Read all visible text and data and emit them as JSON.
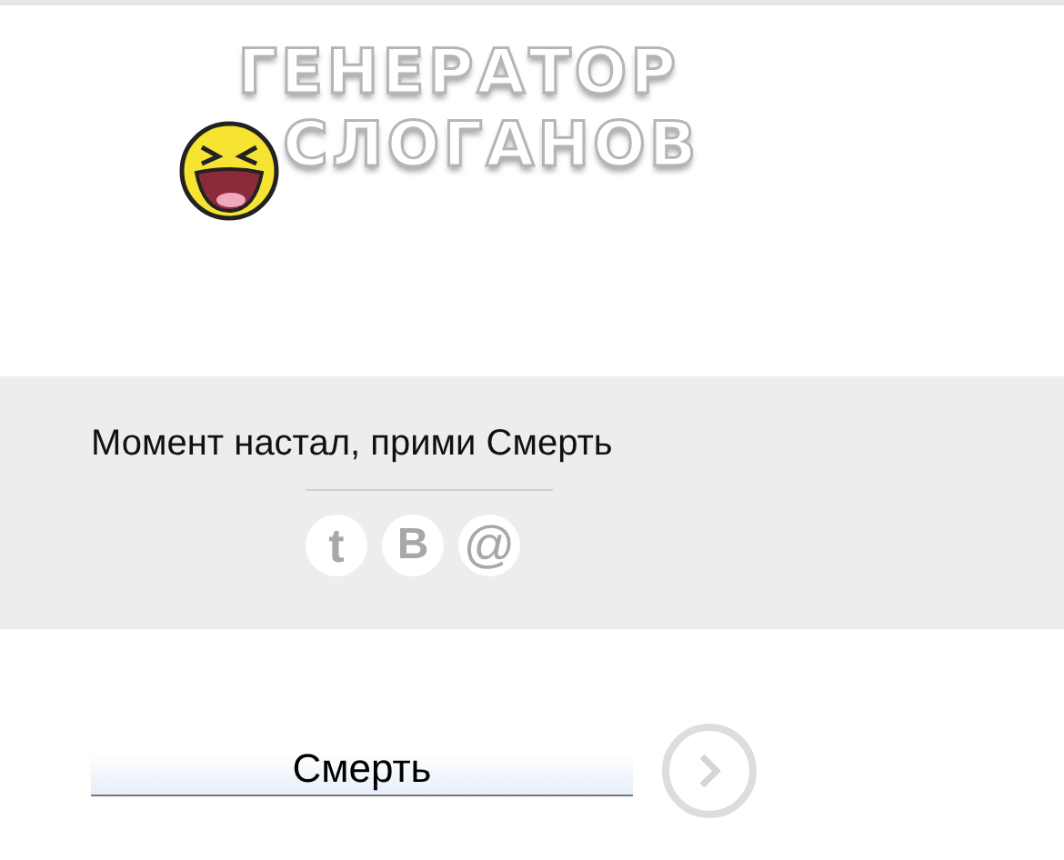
{
  "logo": {
    "lines": [
      "ГЕНЕРАТОР",
      "СЛОГАНОВ"
    ]
  },
  "slogan": "Момент настал, прими Смерть",
  "share_buttons": [
    {
      "kind": "twitter",
      "label": "t"
    },
    {
      "kind": "vk",
      "label": "B"
    },
    {
      "kind": "mail",
      "label": "@"
    }
  ],
  "word_field": {
    "value": "Смерть"
  }
}
